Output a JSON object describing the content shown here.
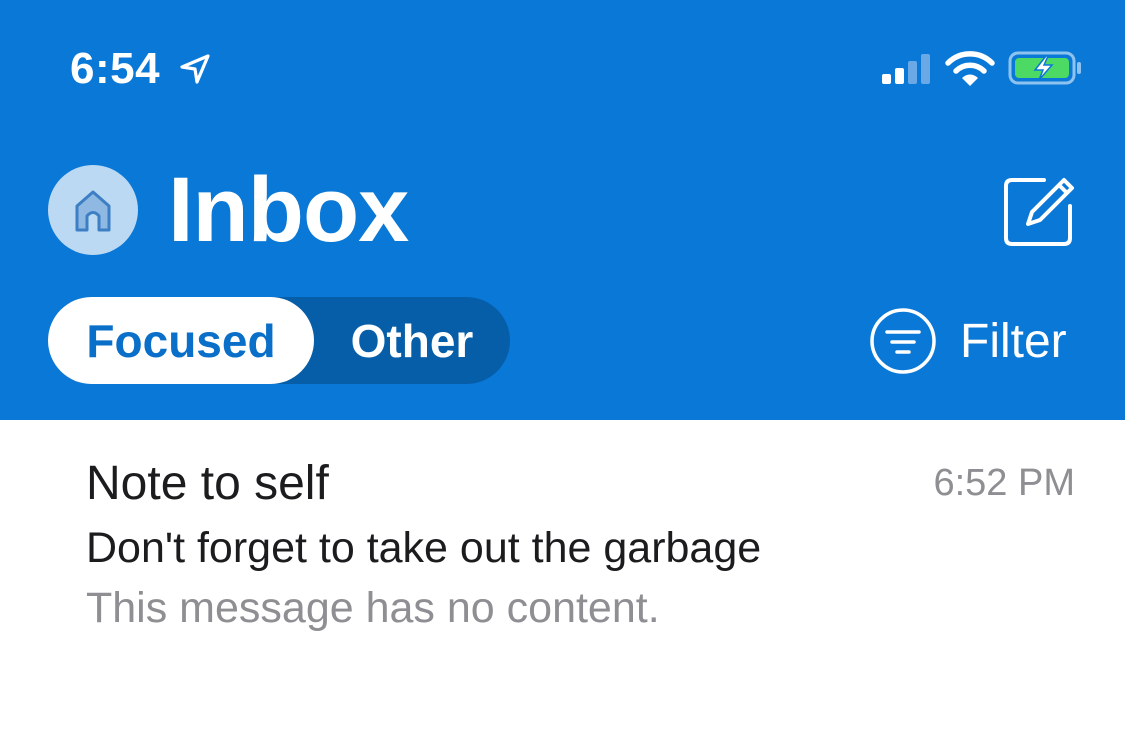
{
  "status_bar": {
    "time": "6:54",
    "icons": [
      "location-arrow-icon",
      "cellular-signal-icon",
      "wifi-icon",
      "battery-charging-icon"
    ],
    "battery_color": "#4cd964"
  },
  "header": {
    "title": "Inbox",
    "background": "#0a78d7",
    "avatar_icon": "home-icon",
    "compose_icon": "compose-icon"
  },
  "tabs": [
    {
      "label": "Focused",
      "selected": true
    },
    {
      "label": "Other",
      "selected": false
    }
  ],
  "filter": {
    "label": "Filter",
    "icon": "filter-icon"
  },
  "messages": [
    {
      "sender": "Note to self",
      "time": "6:52 PM",
      "subject": "Don't forget to take out the garbage",
      "preview": "This message has no content."
    }
  ]
}
